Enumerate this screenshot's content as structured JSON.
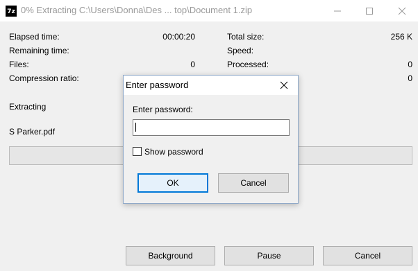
{
  "window": {
    "title": "0% Extracting C:\\Users\\Donna\\Des ... top\\Document 1.zip",
    "app_icon_text": "7z",
    "controls": [
      "minimize",
      "maximize",
      "close"
    ]
  },
  "stats": {
    "elapsed_label": "Elapsed time:",
    "elapsed_value": "00:00:20",
    "remaining_label": "Remaining time:",
    "remaining_value": "",
    "files_label": "Files:",
    "files_value": "0",
    "compression_label": "Compression ratio:",
    "compression_value": "",
    "total_size_label": "Total size:",
    "total_size_value": "256 K",
    "speed_label": "Speed:",
    "speed_value": "",
    "processed_label": "Processed:",
    "processed_value": "0",
    "packed_value": "0"
  },
  "status": {
    "operation": "Extracting",
    "current_file": "S Parker.pdf",
    "progress_fraction": 0
  },
  "buttons": {
    "background": "Background",
    "pause": "Pause",
    "cancel": "Cancel"
  },
  "dialog": {
    "title": "Enter password",
    "prompt": "Enter password:",
    "password_value": "",
    "show_password_label": "Show password",
    "show_password_checked": false,
    "ok": "OK",
    "cancel": "Cancel"
  },
  "colors": {
    "window_bg": "#f0f0f0",
    "titlebar_bg": "#ffffff",
    "accent": "#0078d7"
  }
}
